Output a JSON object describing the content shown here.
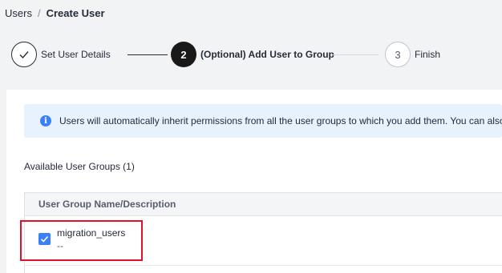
{
  "breadcrumb": {
    "parent": "Users",
    "separator": "/",
    "current": "Create User"
  },
  "stepper": {
    "steps": [
      {
        "number": "",
        "label": "Set User Details",
        "state": "completed"
      },
      {
        "number": "2",
        "label": "(Optional) Add User to Group",
        "state": "active"
      },
      {
        "number": "3",
        "label": "Finish",
        "state": "pending"
      }
    ]
  },
  "info": {
    "icon": "info-icon",
    "text": "Users will automatically inherit permissions from all the user groups to which you add them. You can also"
  },
  "groups": {
    "title": "Available User Groups (1)",
    "table": {
      "column_header": "User Group Name/Description",
      "rows": [
        {
          "name": "migration_users",
          "description": "--",
          "checked": true
        }
      ]
    }
  },
  "colors": {
    "accent": "#3b81f6",
    "info_bg": "#e8f1fe",
    "highlight": "#e3102a"
  }
}
